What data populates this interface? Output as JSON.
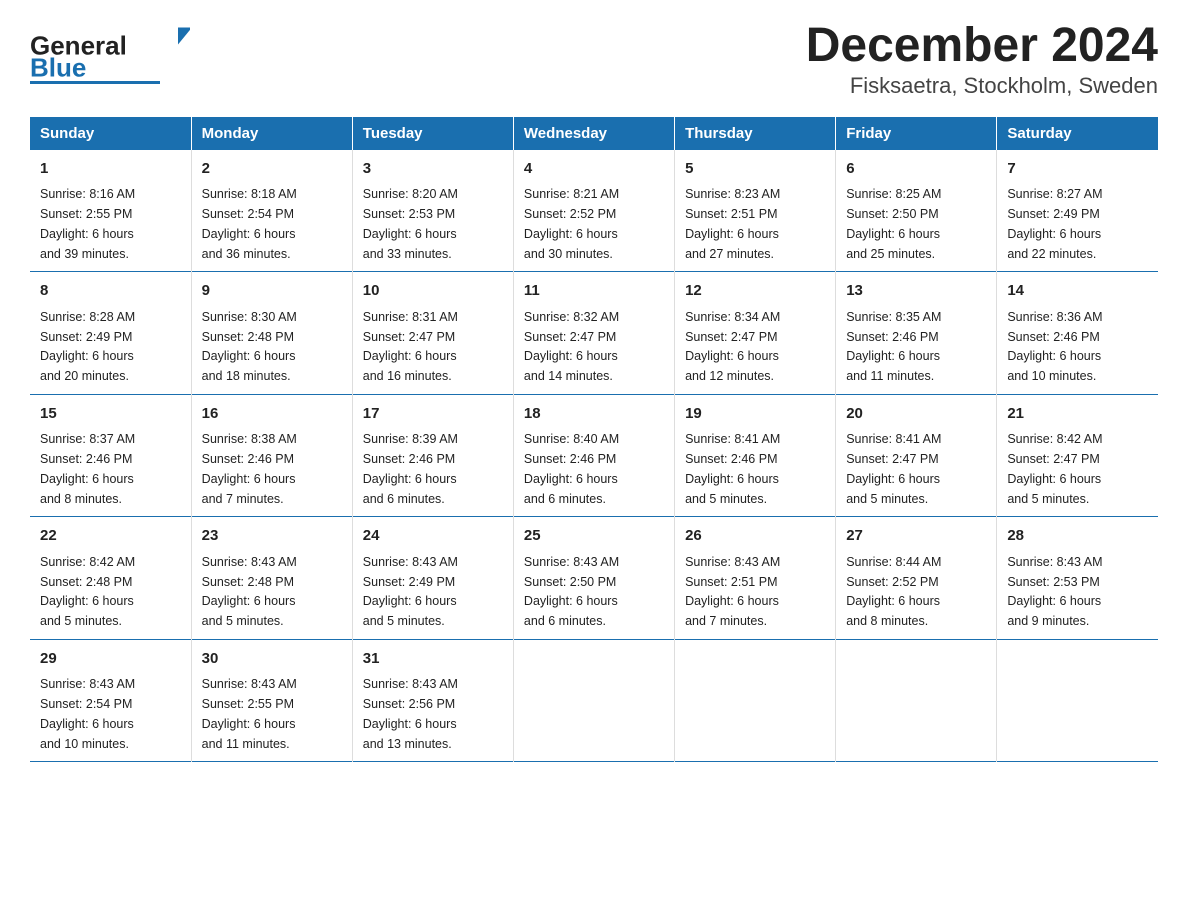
{
  "header": {
    "title": "December 2024",
    "subtitle": "Fisksaetra, Stockholm, Sweden",
    "logo_general": "General",
    "logo_blue": "Blue"
  },
  "days_of_week": [
    "Sunday",
    "Monday",
    "Tuesday",
    "Wednesday",
    "Thursday",
    "Friday",
    "Saturday"
  ],
  "weeks": [
    [
      {
        "date": "1",
        "sunrise": "8:16 AM",
        "sunset": "2:55 PM",
        "daylight_hours": "6",
        "daylight_minutes": "39"
      },
      {
        "date": "2",
        "sunrise": "8:18 AM",
        "sunset": "2:54 PM",
        "daylight_hours": "6",
        "daylight_minutes": "36"
      },
      {
        "date": "3",
        "sunrise": "8:20 AM",
        "sunset": "2:53 PM",
        "daylight_hours": "6",
        "daylight_minutes": "33"
      },
      {
        "date": "4",
        "sunrise": "8:21 AM",
        "sunset": "2:52 PM",
        "daylight_hours": "6",
        "daylight_minutes": "30"
      },
      {
        "date": "5",
        "sunrise": "8:23 AM",
        "sunset": "2:51 PM",
        "daylight_hours": "6",
        "daylight_minutes": "27"
      },
      {
        "date": "6",
        "sunrise": "8:25 AM",
        "sunset": "2:50 PM",
        "daylight_hours": "6",
        "daylight_minutes": "25"
      },
      {
        "date": "7",
        "sunrise": "8:27 AM",
        "sunset": "2:49 PM",
        "daylight_hours": "6",
        "daylight_minutes": "22"
      }
    ],
    [
      {
        "date": "8",
        "sunrise": "8:28 AM",
        "sunset": "2:49 PM",
        "daylight_hours": "6",
        "daylight_minutes": "20"
      },
      {
        "date": "9",
        "sunrise": "8:30 AM",
        "sunset": "2:48 PM",
        "daylight_hours": "6",
        "daylight_minutes": "18"
      },
      {
        "date": "10",
        "sunrise": "8:31 AM",
        "sunset": "2:47 PM",
        "daylight_hours": "6",
        "daylight_minutes": "16"
      },
      {
        "date": "11",
        "sunrise": "8:32 AM",
        "sunset": "2:47 PM",
        "daylight_hours": "6",
        "daylight_minutes": "14"
      },
      {
        "date": "12",
        "sunrise": "8:34 AM",
        "sunset": "2:47 PM",
        "daylight_hours": "6",
        "daylight_minutes": "12"
      },
      {
        "date": "13",
        "sunrise": "8:35 AM",
        "sunset": "2:46 PM",
        "daylight_hours": "6",
        "daylight_minutes": "11"
      },
      {
        "date": "14",
        "sunrise": "8:36 AM",
        "sunset": "2:46 PM",
        "daylight_hours": "6",
        "daylight_minutes": "10"
      }
    ],
    [
      {
        "date": "15",
        "sunrise": "8:37 AM",
        "sunset": "2:46 PM",
        "daylight_hours": "6",
        "daylight_minutes": "8"
      },
      {
        "date": "16",
        "sunrise": "8:38 AM",
        "sunset": "2:46 PM",
        "daylight_hours": "6",
        "daylight_minutes": "7"
      },
      {
        "date": "17",
        "sunrise": "8:39 AM",
        "sunset": "2:46 PM",
        "daylight_hours": "6",
        "daylight_minutes": "6"
      },
      {
        "date": "18",
        "sunrise": "8:40 AM",
        "sunset": "2:46 PM",
        "daylight_hours": "6",
        "daylight_minutes": "6"
      },
      {
        "date": "19",
        "sunrise": "8:41 AM",
        "sunset": "2:46 PM",
        "daylight_hours": "6",
        "daylight_minutes": "5"
      },
      {
        "date": "20",
        "sunrise": "8:41 AM",
        "sunset": "2:47 PM",
        "daylight_hours": "6",
        "daylight_minutes": "5"
      },
      {
        "date": "21",
        "sunrise": "8:42 AM",
        "sunset": "2:47 PM",
        "daylight_hours": "6",
        "daylight_minutes": "5"
      }
    ],
    [
      {
        "date": "22",
        "sunrise": "8:42 AM",
        "sunset": "2:48 PM",
        "daylight_hours": "6",
        "daylight_minutes": "5"
      },
      {
        "date": "23",
        "sunrise": "8:43 AM",
        "sunset": "2:48 PM",
        "daylight_hours": "6",
        "daylight_minutes": "5"
      },
      {
        "date": "24",
        "sunrise": "8:43 AM",
        "sunset": "2:49 PM",
        "daylight_hours": "6",
        "daylight_minutes": "5"
      },
      {
        "date": "25",
        "sunrise": "8:43 AM",
        "sunset": "2:50 PM",
        "daylight_hours": "6",
        "daylight_minutes": "6"
      },
      {
        "date": "26",
        "sunrise": "8:43 AM",
        "sunset": "2:51 PM",
        "daylight_hours": "6",
        "daylight_minutes": "7"
      },
      {
        "date": "27",
        "sunrise": "8:44 AM",
        "sunset": "2:52 PM",
        "daylight_hours": "6",
        "daylight_minutes": "8"
      },
      {
        "date": "28",
        "sunrise": "8:43 AM",
        "sunset": "2:53 PM",
        "daylight_hours": "6",
        "daylight_minutes": "9"
      }
    ],
    [
      {
        "date": "29",
        "sunrise": "8:43 AM",
        "sunset": "2:54 PM",
        "daylight_hours": "6",
        "daylight_minutes": "10"
      },
      {
        "date": "30",
        "sunrise": "8:43 AM",
        "sunset": "2:55 PM",
        "daylight_hours": "6",
        "daylight_minutes": "11"
      },
      {
        "date": "31",
        "sunrise": "8:43 AM",
        "sunset": "2:56 PM",
        "daylight_hours": "6",
        "daylight_minutes": "13"
      },
      null,
      null,
      null,
      null
    ]
  ]
}
